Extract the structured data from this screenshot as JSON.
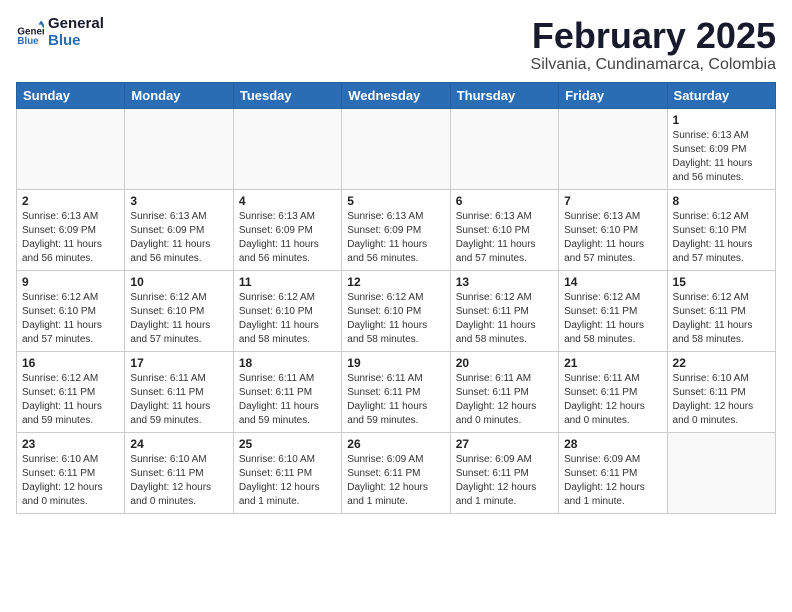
{
  "logo": {
    "line1": "General",
    "line2": "Blue"
  },
  "title": "February 2025",
  "subtitle": "Silvania, Cundinamarca, Colombia",
  "headers": [
    "Sunday",
    "Monday",
    "Tuesday",
    "Wednesday",
    "Thursday",
    "Friday",
    "Saturday"
  ],
  "weeks": [
    [
      {
        "day": "",
        "info": ""
      },
      {
        "day": "",
        "info": ""
      },
      {
        "day": "",
        "info": ""
      },
      {
        "day": "",
        "info": ""
      },
      {
        "day": "",
        "info": ""
      },
      {
        "day": "",
        "info": ""
      },
      {
        "day": "1",
        "info": "Sunrise: 6:13 AM\nSunset: 6:09 PM\nDaylight: 11 hours and 56 minutes."
      }
    ],
    [
      {
        "day": "2",
        "info": "Sunrise: 6:13 AM\nSunset: 6:09 PM\nDaylight: 11 hours and 56 minutes."
      },
      {
        "day": "3",
        "info": "Sunrise: 6:13 AM\nSunset: 6:09 PM\nDaylight: 11 hours and 56 minutes."
      },
      {
        "day": "4",
        "info": "Sunrise: 6:13 AM\nSunset: 6:09 PM\nDaylight: 11 hours and 56 minutes."
      },
      {
        "day": "5",
        "info": "Sunrise: 6:13 AM\nSunset: 6:09 PM\nDaylight: 11 hours and 56 minutes."
      },
      {
        "day": "6",
        "info": "Sunrise: 6:13 AM\nSunset: 6:10 PM\nDaylight: 11 hours and 57 minutes."
      },
      {
        "day": "7",
        "info": "Sunrise: 6:13 AM\nSunset: 6:10 PM\nDaylight: 11 hours and 57 minutes."
      },
      {
        "day": "8",
        "info": "Sunrise: 6:12 AM\nSunset: 6:10 PM\nDaylight: 11 hours and 57 minutes."
      }
    ],
    [
      {
        "day": "9",
        "info": "Sunrise: 6:12 AM\nSunset: 6:10 PM\nDaylight: 11 hours and 57 minutes."
      },
      {
        "day": "10",
        "info": "Sunrise: 6:12 AM\nSunset: 6:10 PM\nDaylight: 11 hours and 57 minutes."
      },
      {
        "day": "11",
        "info": "Sunrise: 6:12 AM\nSunset: 6:10 PM\nDaylight: 11 hours and 58 minutes."
      },
      {
        "day": "12",
        "info": "Sunrise: 6:12 AM\nSunset: 6:10 PM\nDaylight: 11 hours and 58 minutes."
      },
      {
        "day": "13",
        "info": "Sunrise: 6:12 AM\nSunset: 6:11 PM\nDaylight: 11 hours and 58 minutes."
      },
      {
        "day": "14",
        "info": "Sunrise: 6:12 AM\nSunset: 6:11 PM\nDaylight: 11 hours and 58 minutes."
      },
      {
        "day": "15",
        "info": "Sunrise: 6:12 AM\nSunset: 6:11 PM\nDaylight: 11 hours and 58 minutes."
      }
    ],
    [
      {
        "day": "16",
        "info": "Sunrise: 6:12 AM\nSunset: 6:11 PM\nDaylight: 11 hours and 59 minutes."
      },
      {
        "day": "17",
        "info": "Sunrise: 6:11 AM\nSunset: 6:11 PM\nDaylight: 11 hours and 59 minutes."
      },
      {
        "day": "18",
        "info": "Sunrise: 6:11 AM\nSunset: 6:11 PM\nDaylight: 11 hours and 59 minutes."
      },
      {
        "day": "19",
        "info": "Sunrise: 6:11 AM\nSunset: 6:11 PM\nDaylight: 11 hours and 59 minutes."
      },
      {
        "day": "20",
        "info": "Sunrise: 6:11 AM\nSunset: 6:11 PM\nDaylight: 12 hours and 0 minutes."
      },
      {
        "day": "21",
        "info": "Sunrise: 6:11 AM\nSunset: 6:11 PM\nDaylight: 12 hours and 0 minutes."
      },
      {
        "day": "22",
        "info": "Sunrise: 6:10 AM\nSunset: 6:11 PM\nDaylight: 12 hours and 0 minutes."
      }
    ],
    [
      {
        "day": "23",
        "info": "Sunrise: 6:10 AM\nSunset: 6:11 PM\nDaylight: 12 hours and 0 minutes."
      },
      {
        "day": "24",
        "info": "Sunrise: 6:10 AM\nSunset: 6:11 PM\nDaylight: 12 hours and 0 minutes."
      },
      {
        "day": "25",
        "info": "Sunrise: 6:10 AM\nSunset: 6:11 PM\nDaylight: 12 hours and 1 minute."
      },
      {
        "day": "26",
        "info": "Sunrise: 6:09 AM\nSunset: 6:11 PM\nDaylight: 12 hours and 1 minute."
      },
      {
        "day": "27",
        "info": "Sunrise: 6:09 AM\nSunset: 6:11 PM\nDaylight: 12 hours and 1 minute."
      },
      {
        "day": "28",
        "info": "Sunrise: 6:09 AM\nSunset: 6:11 PM\nDaylight: 12 hours and 1 minute."
      },
      {
        "day": "",
        "info": ""
      }
    ]
  ]
}
